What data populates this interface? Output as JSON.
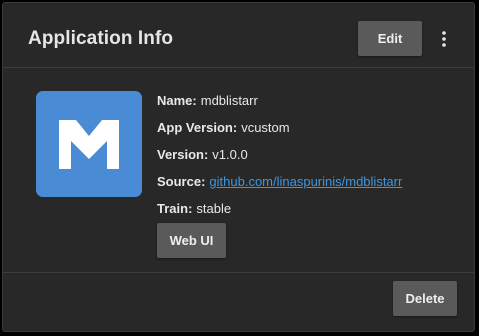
{
  "card": {
    "title": "Application Info",
    "edit_label": "Edit",
    "menu_icon": "more-vertical-icon"
  },
  "app": {
    "logo_icon": "mdblistarr-logo-icon",
    "logo_color": "#4a8bd6",
    "fields": [
      {
        "key": "Name:",
        "value": "mdblistarr"
      },
      {
        "key": "App Version:",
        "value": "vcustom"
      },
      {
        "key": "Version:",
        "value": "v1.0.0"
      },
      {
        "key": "Source:",
        "value": "github.com/linaspurinis/mdblistarr"
      },
      {
        "key": "Train:",
        "value": "stable"
      }
    ],
    "web_ui_label": "Web UI"
  },
  "footer": {
    "delete_label": "Delete"
  },
  "colors": {
    "card_bg": "#282828",
    "button_bg": "#5a5a5a",
    "link": "#3f96e0"
  }
}
